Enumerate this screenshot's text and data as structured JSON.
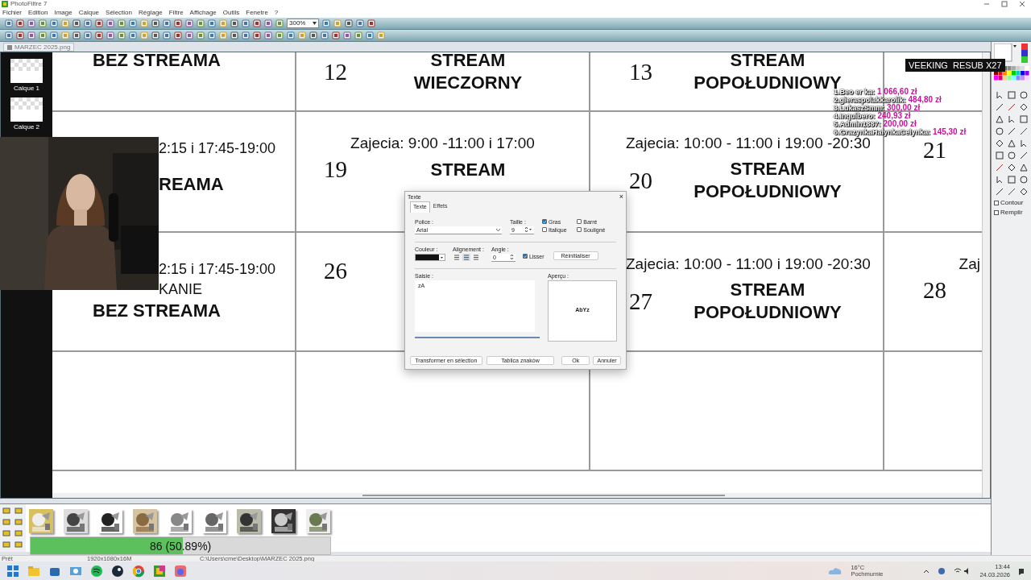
{
  "window": {
    "title": "PhotoFiltre 7"
  },
  "menu": [
    "Fichier",
    "Edition",
    "Image",
    "Calque",
    "Sélection",
    "Réglage",
    "Filtre",
    "Affichage",
    "Outils",
    "Fenetre",
    "?"
  ],
  "toolbar": {
    "zoom": "300%"
  },
  "document_tab": "MARZEC 2025.png",
  "layers": [
    "Calque 1",
    "Calque 2"
  ],
  "calendar": {
    "rows": [
      [
        {
          "lines": [
            {
              "kind": "title",
              "text": "BEZ STREAMA"
            }
          ]
        },
        {
          "date": "12",
          "lines": [
            {
              "kind": "title",
              "text": "STREAM"
            },
            {
              "kind": "title",
              "text": "WIECZORNY"
            }
          ]
        },
        {
          "date": "13",
          "lines": [
            {
              "kind": "title",
              "text": "STREAM"
            },
            {
              "kind": "title",
              "text": "POPOŁUDNIOWY"
            }
          ]
        },
        {}
      ],
      [
        {
          "lines": [
            {
              "kind": "cut",
              "text": "2:15 i 17:45-19:00"
            },
            {
              "kind": "cuttitle",
              "text": "REAMA"
            }
          ]
        },
        {
          "schedule": "Zajecia: 9:00 -11:00 i 17:00",
          "date": "19",
          "lines": [
            {
              "kind": "title",
              "text": "STREAM"
            }
          ]
        },
        {
          "schedule": "Zajecia: 10:00 - 11:00 i 19:00 -20:30",
          "date": "20",
          "lines": [
            {
              "kind": "title",
              "text": "STREAM"
            },
            {
              "kind": "title",
              "text": "POPOŁUDNIOWY"
            }
          ]
        },
        {
          "date": "21"
        }
      ],
      [
        {
          "lines": [
            {
              "kind": "cut",
              "text": "2:15 i 17:45-19:00"
            },
            {
              "kind": "cut",
              "text": "KANIE"
            },
            {
              "kind": "title",
              "text": "BEZ STREAMA"
            }
          ]
        },
        {
          "date": "26"
        },
        {
          "schedule": "Zajecia: 10:00 - 11:00 i 19:00 -20:30",
          "date": "27",
          "lines": [
            {
              "kind": "title",
              "text": "STREAM"
            },
            {
              "kind": "title",
              "text": "POPOŁUDNIOWY"
            }
          ]
        },
        {
          "schedule": "Zaj",
          "date": "28"
        }
      ]
    ]
  },
  "overlay": {
    "banner": "VEEKING  RESUB X27",
    "donations": [
      {
        "name": "1.Beo er ka:",
        "amount": "1 066,60 zł"
      },
      {
        "name": "2.gieraspolakkarolik:",
        "amount": "484,80 zł"
      },
      {
        "name": "3.LukaszSmm:",
        "amount": "300,00 zł"
      },
      {
        "name": "4.Inquibero:",
        "amount": "240,93 zł"
      },
      {
        "name": "5.Admin1887:",
        "amount": "200,00 zł"
      },
      {
        "name": "6.GrazynkaHalynkaCelynka:",
        "amount": "145,30 zł"
      }
    ]
  },
  "dialog": {
    "title": "Texte",
    "close": "×",
    "tabs": [
      {
        "label": "Texte",
        "selected": true
      },
      {
        "label": "Effets",
        "selected": false
      }
    ],
    "font_label": "Police :",
    "font": "Arial",
    "size_label": "Taille :",
    "size": "9",
    "styles": [
      {
        "label": "Gras",
        "checked": true
      },
      {
        "label": "Barré",
        "checked": false
      },
      {
        "label": "Italique",
        "checked": false
      },
      {
        "label": "Souligné",
        "checked": false
      }
    ],
    "color_label": "Couleur :",
    "align_label": "Alignement :",
    "alignments": [
      {
        "selected": false
      },
      {
        "selected": true
      },
      {
        "selected": false
      }
    ],
    "angle_label": "Angle :",
    "angle": "0",
    "smooth": {
      "label": "Lisser",
      "checked": true
    },
    "reset": "Réinitialiser",
    "input_label": "Saisie :",
    "input": "zA",
    "preview_label": "Aperçu :",
    "preview": "AbYz",
    "buttons": [
      "Transformer en sélection",
      "Tablica znaków",
      "Ok",
      "Annuler"
    ]
  },
  "tools_panel": {
    "options": [
      {
        "label": "Contour",
        "checked": false
      },
      {
        "label": "Remplir",
        "checked": false
      }
    ]
  },
  "progress": {
    "text": "86 (50.89%)",
    "level": 0.5089
  },
  "status_bar": [
    "Prêt",
    "1920x1080x16M",
    "C:\\Users\\cme\\Desktop\\MARZEC 2025.png"
  ],
  "taskbar": {
    "weather": {
      "temp": "16°C",
      "sky": "Pochmurnie"
    },
    "time": "13:44",
    "date": "24.03.2026"
  }
}
